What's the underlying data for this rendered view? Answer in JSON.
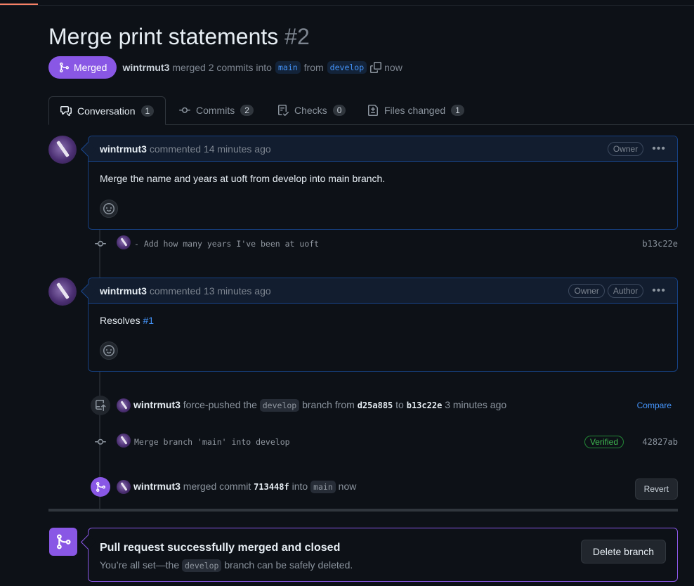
{
  "pr": {
    "title": "Merge print statements",
    "number": "#2",
    "state": "Merged",
    "author": "wintrmut3",
    "action": "merged 2 commits into",
    "base_branch": "main",
    "from_word": "from",
    "head_branch": "develop",
    "time": "now"
  },
  "tabs": [
    {
      "label": "Conversation",
      "count": "1",
      "icon": "comment-discussion-icon"
    },
    {
      "label": "Commits",
      "count": "2",
      "icon": "git-commit-icon"
    },
    {
      "label": "Checks",
      "count": "0",
      "icon": "checklist-icon"
    },
    {
      "label": "Files changed",
      "count": "1",
      "icon": "file-diff-icon"
    }
  ],
  "comments": [
    {
      "author": "wintrmut3",
      "meta": "commented 14 minutes ago",
      "labels": [
        "Owner"
      ],
      "body": "Merge the name and years at uoft from develop into main branch."
    },
    {
      "author": "wintrmut3",
      "meta": "commented 13 minutes ago",
      "labels": [
        "Owner",
        "Author"
      ],
      "body_prefix": "Resolves",
      "body_link": "#1"
    }
  ],
  "commits": [
    {
      "message": "- Add how many years I've been at uoft",
      "sha": "b13c22e"
    },
    {
      "message": "Merge branch 'main' into develop",
      "sha": "42827ab",
      "badge": "Verified"
    }
  ],
  "force_push": {
    "author": "wintrmut3",
    "text1": "force-pushed the",
    "branch": "develop",
    "text2": "branch from",
    "from_sha": "d25a885",
    "text3": "to",
    "to_sha": "b13c22e",
    "time": "3 minutes ago",
    "compare_label": "Compare"
  },
  "merge_event": {
    "author": "wintrmut3",
    "text1": "merged commit",
    "sha": "713448f",
    "text2": "into",
    "branch": "main",
    "time": "now",
    "revert_label": "Revert"
  },
  "merge_box": {
    "heading": "Pull request successfully merged and closed",
    "sub_prefix": "You’re all set—the",
    "branch": "develop",
    "sub_suffix": "branch can be safely deleted.",
    "delete_label": "Delete branch"
  },
  "colors": {
    "accent": "#8957e5",
    "link": "#4493f8",
    "bg": "#0d1117"
  }
}
